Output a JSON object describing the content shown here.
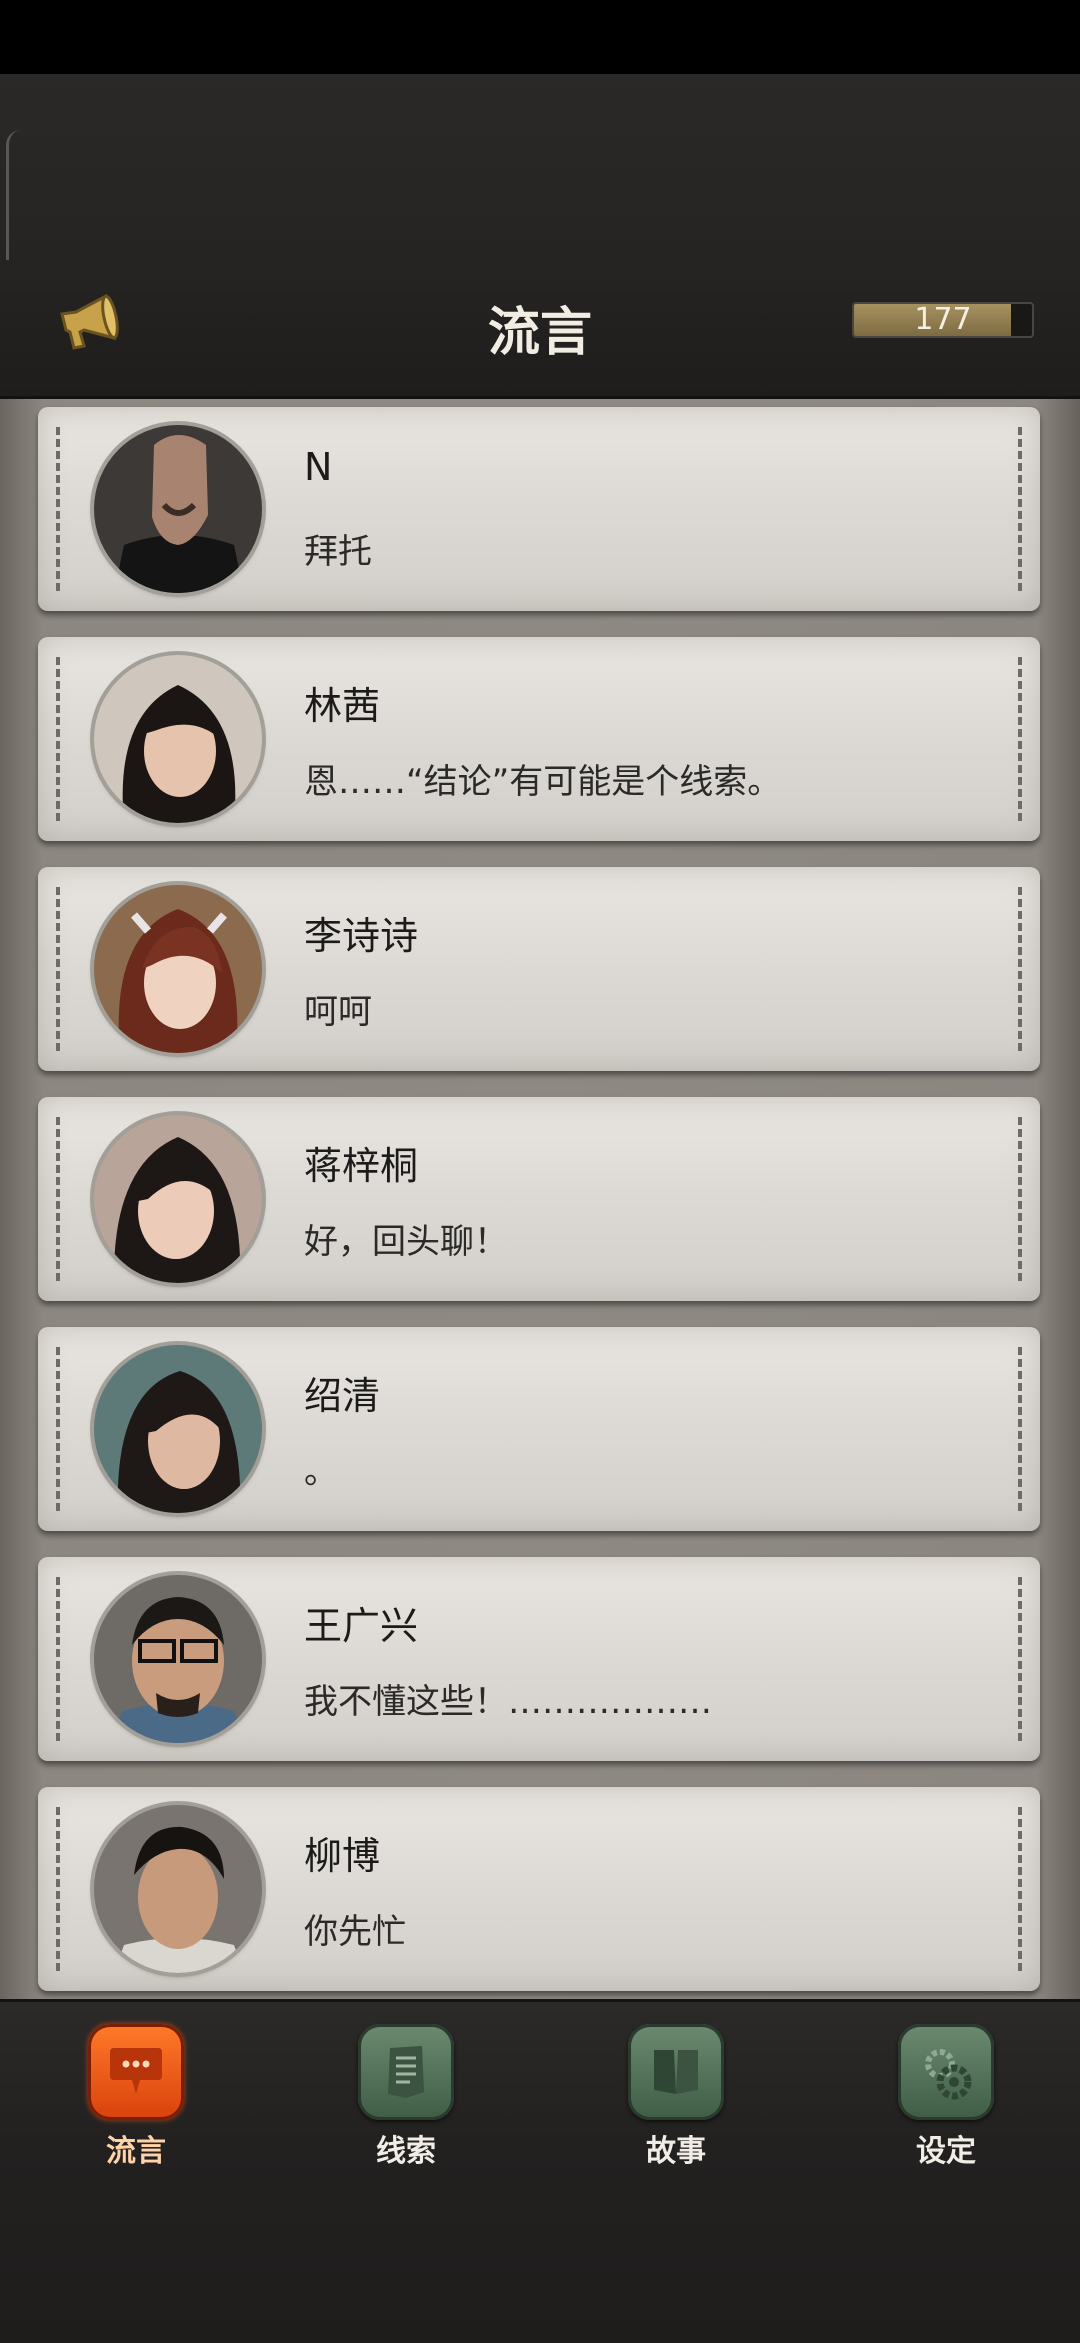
{
  "header": {
    "title": "流言",
    "counter": "177",
    "counter_fill": 0.88
  },
  "contacts": [
    {
      "name": "N",
      "message": "拜托"
    },
    {
      "name": "林茜",
      "message": "恩……“结论”有可能是个线索。"
    },
    {
      "name": "李诗诗",
      "message": "呵呵"
    },
    {
      "name": "蒋梓桐",
      "message": "好，回头聊！"
    },
    {
      "name": "绍清",
      "message": "。"
    },
    {
      "name": "王广兴",
      "message": "我不懂这些！………………"
    },
    {
      "name": "柳博",
      "message": "你先忙"
    }
  ],
  "tabs": [
    {
      "label": "流言",
      "icon": "chat-bubble-icon",
      "active": true
    },
    {
      "label": "线索",
      "icon": "notes-icon",
      "active": false
    },
    {
      "label": "故事",
      "icon": "book-icon",
      "active": false
    },
    {
      "label": "设定",
      "icon": "gear-icon",
      "active": false
    }
  ],
  "colors": {
    "accent": "#e45415",
    "tab_green": "#557a5c",
    "gold": "#c8a24a"
  }
}
